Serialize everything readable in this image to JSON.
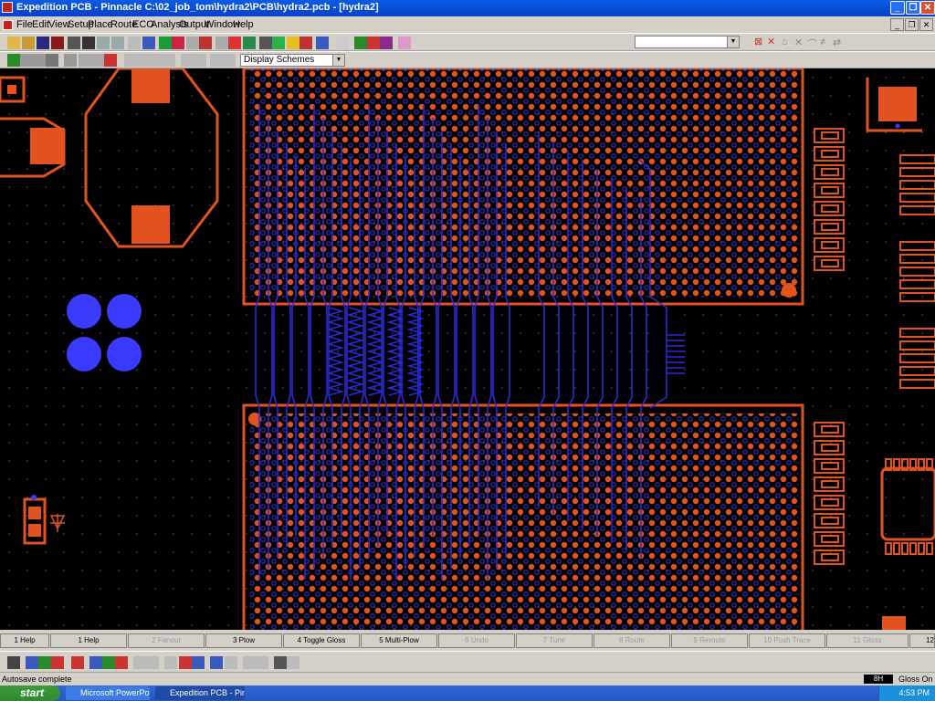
{
  "window": {
    "title": "Expedition PCB - Pinnacle  C:\\02_job_tom\\hydra2\\PCB\\hydra2.pcb - [hydra2]"
  },
  "menu": [
    "File",
    "Edit",
    "View",
    "Setup",
    "Place",
    "Route",
    "ECO",
    "Analysis",
    "Output",
    "Window",
    "Help"
  ],
  "toolbar": {
    "display_schemes": "Display Schemes",
    "top_dropdown_value": ""
  },
  "fkeys": [
    {
      "label": "1 Help",
      "enabled": true
    },
    {
      "label": "1 Help",
      "enabled": true
    },
    {
      "label": "2 Fanout",
      "enabled": false
    },
    {
      "label": "3 Plow",
      "enabled": true
    },
    {
      "label": "4 Toggle Gloss",
      "enabled": true
    },
    {
      "label": "5 Multi-Plow",
      "enabled": true
    },
    {
      "label": "6 Undo",
      "enabled": false
    },
    {
      "label": "7 Tune",
      "enabled": false
    },
    {
      "label": "8 Route",
      "enabled": false
    },
    {
      "label": "9 Reroute",
      "enabled": false
    },
    {
      "label": "10 Push Trace",
      "enabled": false
    },
    {
      "label": "11 Gloss",
      "enabled": false
    },
    {
      "label": "12",
      "enabled": true
    }
  ],
  "status": {
    "message": "Autosave complete",
    "layer": "8H",
    "gloss": "Gloss On"
  },
  "taskbar": {
    "start": "start",
    "tasks": [
      "Microsoft PowerPoint ...",
      "Expedition PCB - Pinn..."
    ],
    "clock": "4:53 PM"
  },
  "colors": {
    "copper": "#e3531f",
    "trace": "#2a2ad6",
    "via_fill": "#3b3bff",
    "background": "#000000",
    "titlebar": "#0a5be6"
  }
}
